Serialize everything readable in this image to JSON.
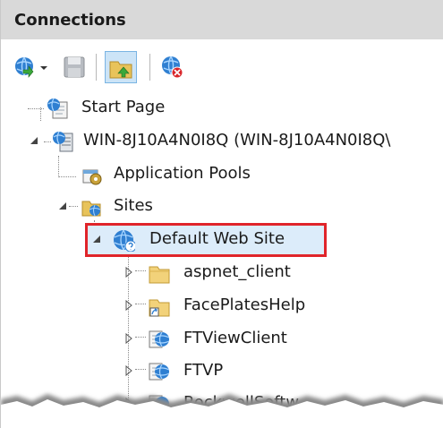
{
  "panel": {
    "title": "Connections"
  },
  "toolbar": {
    "buttons": [
      {
        "name": "connect",
        "icon": "globe-connect-icon"
      },
      {
        "name": "save",
        "icon": "save-disk-icon"
      },
      {
        "name": "up-level",
        "icon": "folder-up-icon",
        "active": true
      },
      {
        "name": "disconnect",
        "icon": "globe-disconnect-icon"
      }
    ]
  },
  "tree": {
    "items": [
      {
        "label": "Start Page",
        "icon": "start-page-icon"
      },
      {
        "label": "WIN-8J10A4N0I8Q (WIN-8J10A4N0I8Q\\",
        "icon": "server-icon",
        "expanded": true
      },
      {
        "label": "Application Pools",
        "icon": "app-pools-icon"
      },
      {
        "label": "Sites",
        "icon": "sites-folder-icon",
        "expanded": true
      },
      {
        "label": "Default Web Site",
        "icon": "website-globe-icon",
        "expanded": true,
        "selected": true
      },
      {
        "label": "aspnet_client",
        "icon": "folder-icon",
        "expanded": false
      },
      {
        "label": "FacePlatesHelp",
        "icon": "folder-shortcut-icon",
        "expanded": false
      },
      {
        "label": "FTViewClient",
        "icon": "web-application-icon",
        "expanded": false
      },
      {
        "label": "FTVP",
        "icon": "web-application-icon",
        "expanded": false
      },
      {
        "label": "RockwellSoftw",
        "icon": "web-application-icon",
        "expanded": false
      }
    ]
  },
  "colors": {
    "highlight_border": "#e0242a",
    "header_bg": "#d9d9d9",
    "selection_bg": "#dcecfa"
  }
}
